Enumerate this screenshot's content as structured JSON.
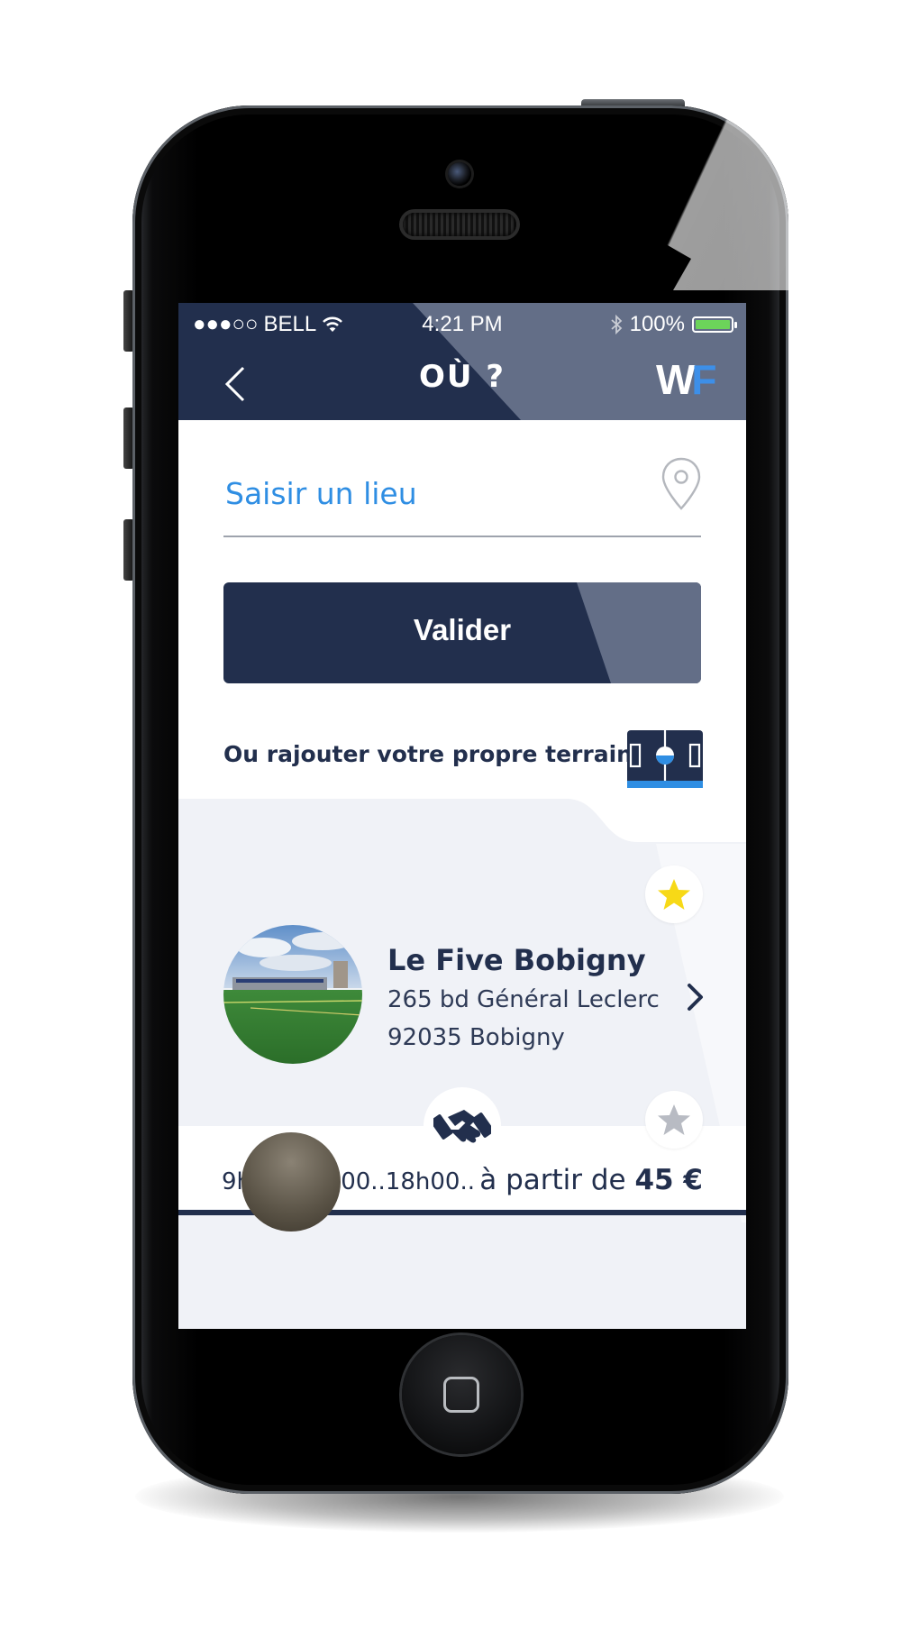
{
  "status_bar": {
    "signal": "●●●○○",
    "carrier": "BELL",
    "time": "4:21 PM",
    "battery": "100%"
  },
  "nav": {
    "title": "OÙ ?",
    "logo_w": "W",
    "logo_f": "F"
  },
  "search": {
    "placeholder": "Saisir un lieu"
  },
  "actions": {
    "validate_label": "Valider",
    "add_field_label": "Ou rajouter votre propre terrain"
  },
  "venues": [
    {
      "name": "Le Five Bobigny",
      "address_line1": "265 bd Général Leclerc",
      "address_line2": "92035 Bobigny",
      "favorite": true,
      "hours": "9h00..12h00..18h00..",
      "price_prefix": "à partir de",
      "price": "45 €"
    },
    {
      "favorite": false
    }
  ],
  "colors": {
    "primary": "#222f4d",
    "accent": "#2f8ee3",
    "list_bg": "#f0f2f7",
    "favorite_on": "#f7d917",
    "favorite_off": "#b8bbc3"
  }
}
